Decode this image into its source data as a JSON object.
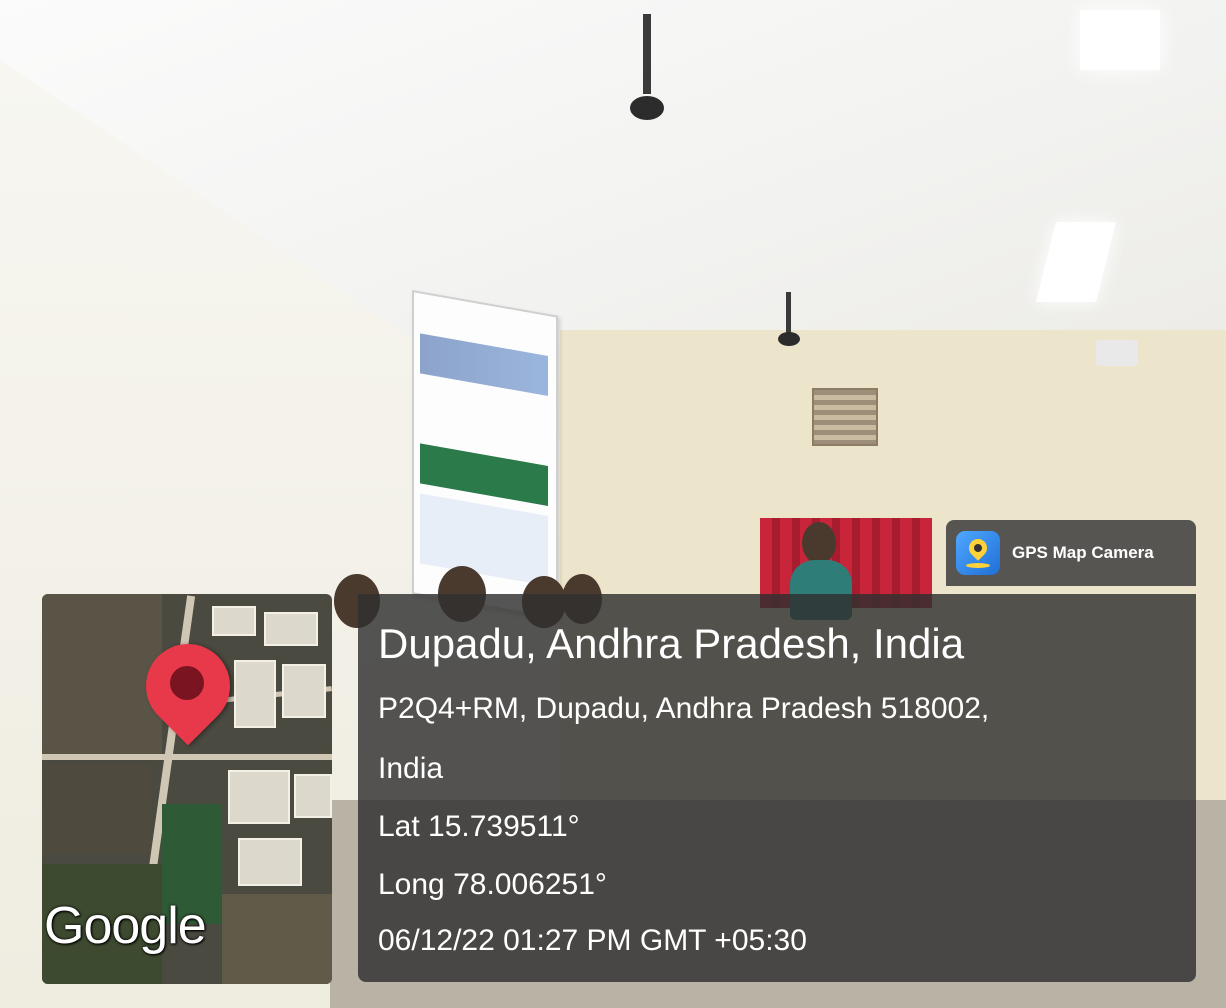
{
  "watermark": {
    "app_name": "GPS Map Camera",
    "app_icon": "gps-camera-pin-icon"
  },
  "location": {
    "title": "Dupadu, Andhra Pradesh, India",
    "address_line1": "P2Q4+RM, Dupadu, Andhra Pradesh 518002,",
    "address_line2": "India",
    "lat": "Lat 15.739511°",
    "long": "Long 78.006251°",
    "datetime": "06/12/22 01:27 PM GMT +05:30"
  },
  "map": {
    "brand": "Google",
    "marker_icon": "location-pin-icon",
    "marker_color": "#e8394a"
  }
}
